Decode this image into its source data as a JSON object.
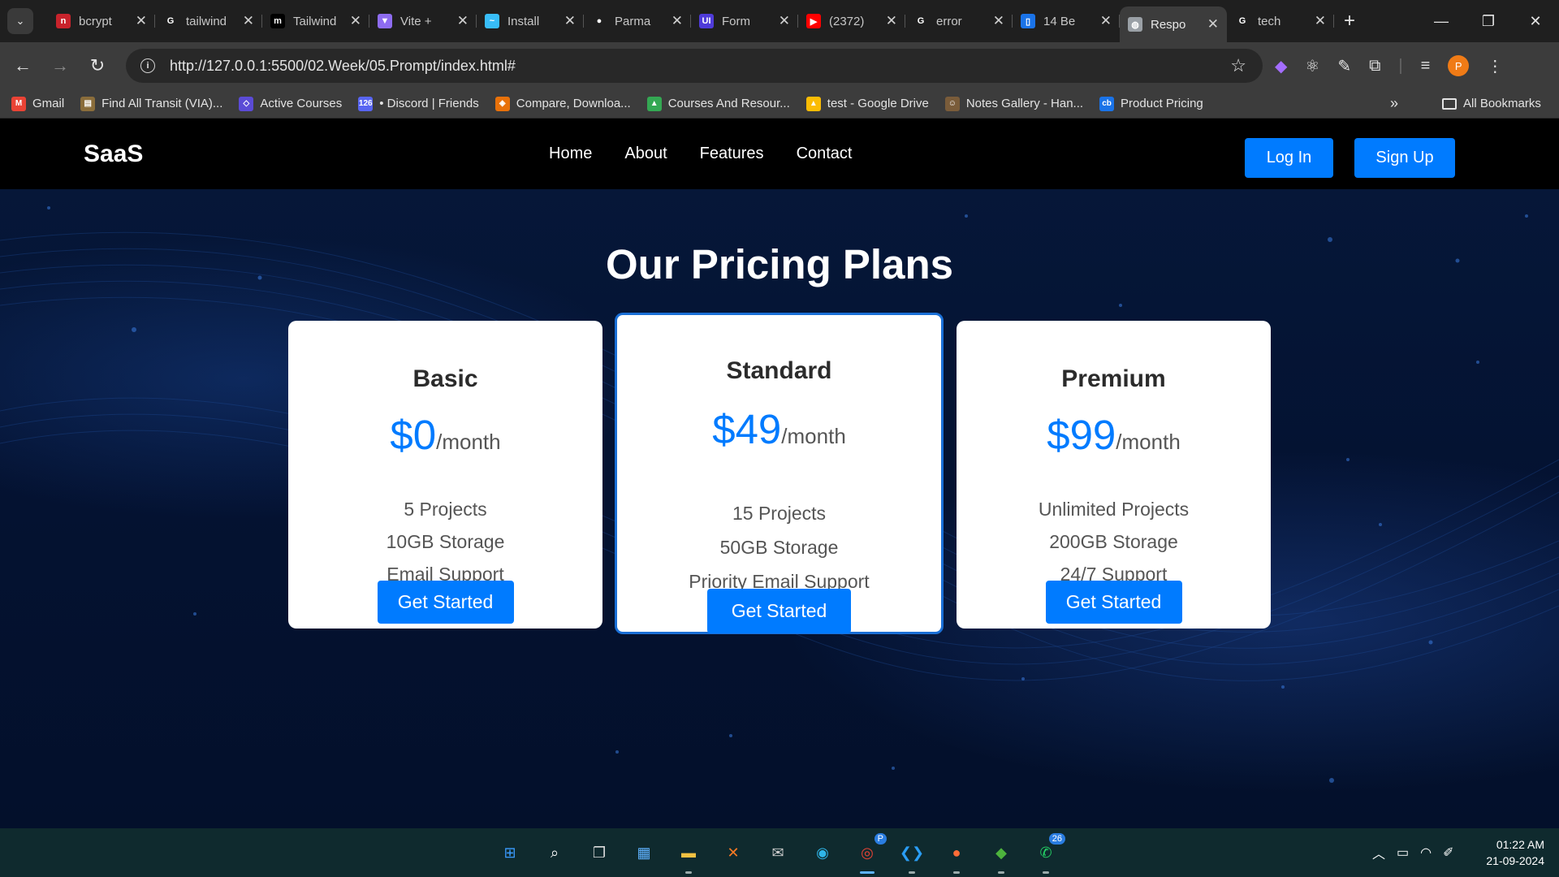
{
  "browser": {
    "tabs": [
      {
        "title": "bcrypt",
        "icon": "red-n-favicon",
        "color": "#c8232c",
        "glyph": "n"
      },
      {
        "title": "tailwind",
        "icon": "google-favicon",
        "color": "#ffffff",
        "glyph": "G"
      },
      {
        "title": "Tailwind",
        "icon": "medium-favicon",
        "color": "#000000",
        "glyph": "m"
      },
      {
        "title": "Vite +",
        "icon": "vite-favicon",
        "color": "#8e6cf0",
        "glyph": "▼"
      },
      {
        "title": "Install",
        "icon": "tailwind-favicon",
        "color": "#38bdf8",
        "glyph": "~"
      },
      {
        "title": "Parma",
        "icon": "github-favicon",
        "color": "#ffffff",
        "glyph": "●"
      },
      {
        "title": "Form",
        "icon": "ui-favicon",
        "color": "#4f3bd9",
        "glyph": "UI"
      },
      {
        "title": "(2372)",
        "icon": "youtube-favicon",
        "color": "#ff0000",
        "glyph": "▶"
      },
      {
        "title": "error",
        "icon": "google-favicon",
        "color": "#ffffff",
        "glyph": "G"
      },
      {
        "title": "14 Be",
        "icon": "doc-favicon",
        "color": "#1a73e8",
        "glyph": "▯"
      },
      {
        "title": "Respo",
        "icon": "globe-favicon",
        "color": "#9aa0a6",
        "glyph": "◍",
        "active": true
      },
      {
        "title": "tech",
        "icon": "google-favicon",
        "color": "#ffffff",
        "glyph": "G"
      }
    ],
    "url": "http://127.0.0.1:5500/02.Week/05.Prompt/index.html#",
    "profile_initial": "P",
    "bookmarks": [
      {
        "label": "Gmail",
        "icon": "gmail-icon",
        "color": "#ea4335",
        "glyph": "M"
      },
      {
        "label": "Find All Transit (VIA)...",
        "icon": "transit-icon",
        "color": "#8a6d3b",
        "glyph": "▤"
      },
      {
        "label": "Active Courses",
        "icon": "courses-icon",
        "color": "#5b4bd6",
        "glyph": "◇"
      },
      {
        "label": "• Discord | Friends",
        "icon": "discord-icon",
        "color": "#5865f2",
        "glyph": "126"
      },
      {
        "label": "Compare, Downloa...",
        "icon": "compare-icon",
        "color": "#e8710a",
        "glyph": "◈"
      },
      {
        "label": "Courses And Resour...",
        "icon": "drive-icon",
        "color": "#34a853",
        "glyph": "▲"
      },
      {
        "label": "test - Google Drive",
        "icon": "drive-icon",
        "color": "#fbbc04",
        "glyph": "▲"
      },
      {
        "label": "Notes Gallery - Han...",
        "icon": "notes-icon",
        "color": "#7a5c3a",
        "glyph": "☺"
      },
      {
        "label": "Product Pricing",
        "icon": "cb-icon",
        "color": "#1a73e8",
        "glyph": "cb"
      }
    ],
    "all_bookmarks": "All Bookmarks"
  },
  "site": {
    "logo": "SaaS",
    "nav": [
      "Home",
      "About",
      "Features",
      "Contact"
    ],
    "login": "Log In",
    "signup": "Sign Up",
    "title": "Our Pricing Plans",
    "accent": "#007bff",
    "plans": [
      {
        "name": "Basic",
        "price": "$0",
        "period": "/month",
        "features": [
          "5 Projects",
          "10GB Storage",
          "Email Support"
        ],
        "cta": "Get Started"
      },
      {
        "name": "Standard",
        "price": "$49",
        "period": "/month",
        "features": [
          "15 Projects",
          "50GB Storage",
          "Priority Email Support"
        ],
        "cta": "Get Started",
        "featured": true
      },
      {
        "name": "Premium",
        "price": "$99",
        "period": "/month",
        "features": [
          "Unlimited Projects",
          "200GB Storage",
          "24/7 Support"
        ],
        "cta": "Get Started"
      }
    ]
  },
  "taskbar": {
    "apps": [
      {
        "name": "start-icon",
        "glyph": "⊞",
        "color": "#3b9cff"
      },
      {
        "name": "search-icon",
        "glyph": "⌕",
        "color": "#ffffff"
      },
      {
        "name": "task-view-icon",
        "glyph": "❐",
        "color": "#dddddd"
      },
      {
        "name": "widgets-icon",
        "glyph": "▦",
        "color": "#5fb2ff"
      },
      {
        "name": "file-explorer-icon",
        "glyph": "▬",
        "color": "#f5c242",
        "running": true
      },
      {
        "name": "xampp-icon",
        "glyph": "✕",
        "color": "#fb7a24"
      },
      {
        "name": "mail-icon",
        "glyph": "✉",
        "color": "#cfcfcf"
      },
      {
        "name": "edge-icon",
        "glyph": "◉",
        "color": "#2fb5e8"
      },
      {
        "name": "chrome-icon",
        "glyph": "◎",
        "color": "#ea4335",
        "active": true,
        "badge": "P"
      },
      {
        "name": "vscode-icon",
        "glyph": "❮❯",
        "color": "#2a9df4",
        "running": true
      },
      {
        "name": "postman-icon",
        "glyph": "●",
        "color": "#ff6c37",
        "running": true
      },
      {
        "name": "mongodb-icon",
        "glyph": "◆",
        "color": "#4db33d",
        "running": true
      },
      {
        "name": "whatsapp-icon",
        "glyph": "✆",
        "color": "#25d366",
        "running": true,
        "badge": "26"
      }
    ],
    "time": "01:22 AM",
    "date": "21-09-2024"
  }
}
